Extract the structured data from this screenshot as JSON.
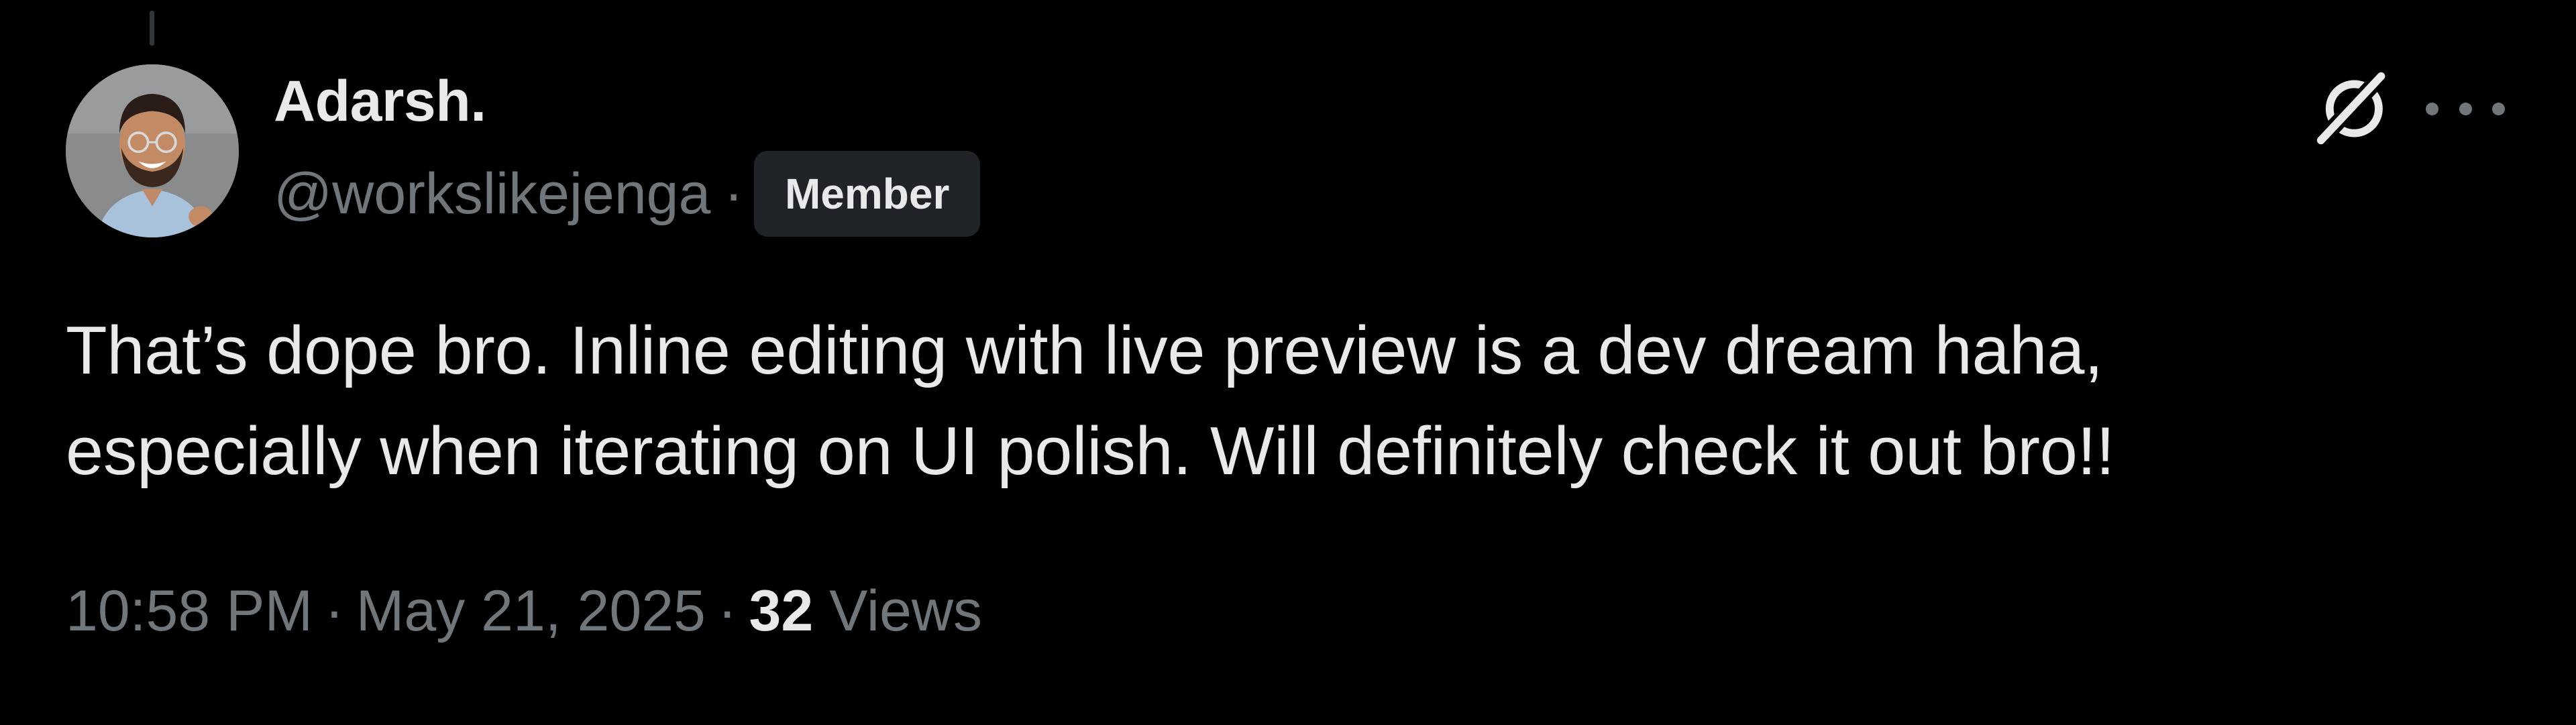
{
  "tweet": {
    "author": {
      "display_name": "Adarsh.",
      "handle": "@workslikejenga",
      "badge": "Member"
    },
    "text_lines": [
      "That’s dope bro. Inline editing with live preview is a dev dream haha,",
      "especially when iterating on UI polish. Will definitely check it out bro!!"
    ],
    "meta": {
      "time": "10:58 PM",
      "separator": "·",
      "date": "May 21, 2025",
      "views_count": "32",
      "views_label": "Views"
    },
    "icons": {
      "grok": "grok-icon",
      "more": "more-options-icon"
    }
  },
  "colors": {
    "background": "#000000",
    "primary_text": "#e7e9ea",
    "secondary_text": "#71767b",
    "badge_bg": "#202327"
  }
}
